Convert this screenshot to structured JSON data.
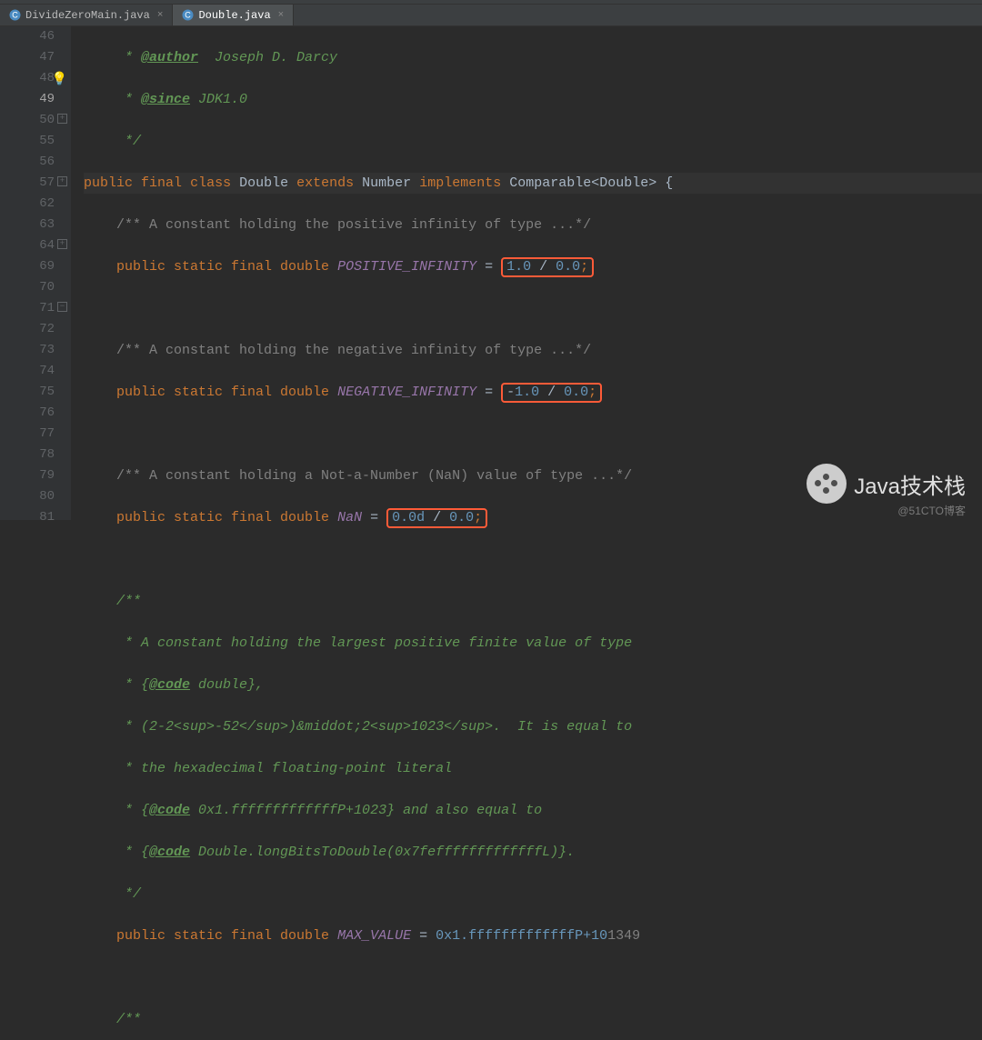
{
  "tabs": [
    {
      "name": "DivideZeroMain.java",
      "active": false
    },
    {
      "name": "Double.java",
      "active": true
    }
  ],
  "gutter": [
    "46",
    "47",
    "48",
    "49",
    "50",
    "55",
    "56",
    "57",
    "62",
    "63",
    "64",
    "69",
    "70",
    "71",
    "72",
    "73",
    "74",
    "75",
    "76",
    "77",
    "78",
    "79",
    "80",
    "81"
  ],
  "code": {
    "l46": {
      "pre": "     * ",
      "tag": "@author",
      "rest": "  Joseph D. Darcy"
    },
    "l47": {
      "pre": "     * ",
      "tag": "@since",
      "rest": " JDK1.0"
    },
    "l48": "     */",
    "l49": {
      "kw1": "public",
      "kw2": "final",
      "kw3": "class",
      "cls1": "Double",
      "kw4": "extends",
      "cls2": "Number",
      "kw5": "implements",
      "type": "Comparable<Double> {"
    },
    "l50": "    /** A constant holding the positive infinity of type ...*/",
    "l55": {
      "mods": "public static final double ",
      "name": "POSITIVE_INFINITY",
      "eq": " = ",
      "boxnum1": "1.0",
      "boxop": " / ",
      "boxnum2": "0.0",
      "semi": ";"
    },
    "l57": "    /** A constant holding the negative infinity of type ...*/",
    "l62": {
      "mods": "public static final double ",
      "name": "NEGATIVE_INFINITY",
      "eq": " = ",
      "boxpre": "-",
      "boxnum1": "1.0",
      "boxop": " / ",
      "boxnum2": "0.0",
      "semi": ";"
    },
    "l64": "    /** A constant holding a Not-a-Number (NaN) value of type ...*/",
    "l69": {
      "mods": "public static final double ",
      "name": "NaN",
      "eq": " = ",
      "boxnum1": "0.0d",
      "boxop": " / ",
      "boxnum2": "0.0",
      "semi": ";"
    },
    "l71": "    /**",
    "l72": "     * A constant holding the largest positive finite value of type",
    "l73a": "     * {",
    "l73b": "@code",
    "l73c": " double},",
    "l74": "     * (2-2<sup>-52</sup>)&middot;2<sup>1023</sup>.  It is equal to",
    "l75": "     * the hexadecimal floating-point literal",
    "l76a": "     * {",
    "l76b": "@code",
    "l76c": " 0x1.fffffffffffffP+1023} and also equal to",
    "l77a": "     * {",
    "l77b": "@code",
    "l77c": " Double.longBitsToDouble(0x7fefffffffffffffL)}.",
    "l78": "     */",
    "l79": {
      "mods": "public static final double ",
      "name": "MAX_VALUE",
      "eq": " = ",
      "hex": "0x1.fffffffffffffP+10",
      "trail": "1349"
    },
    "l81": "    /**"
  },
  "watermark": {
    "text": "Java技术栈",
    "sub": "@51CTO博客"
  }
}
